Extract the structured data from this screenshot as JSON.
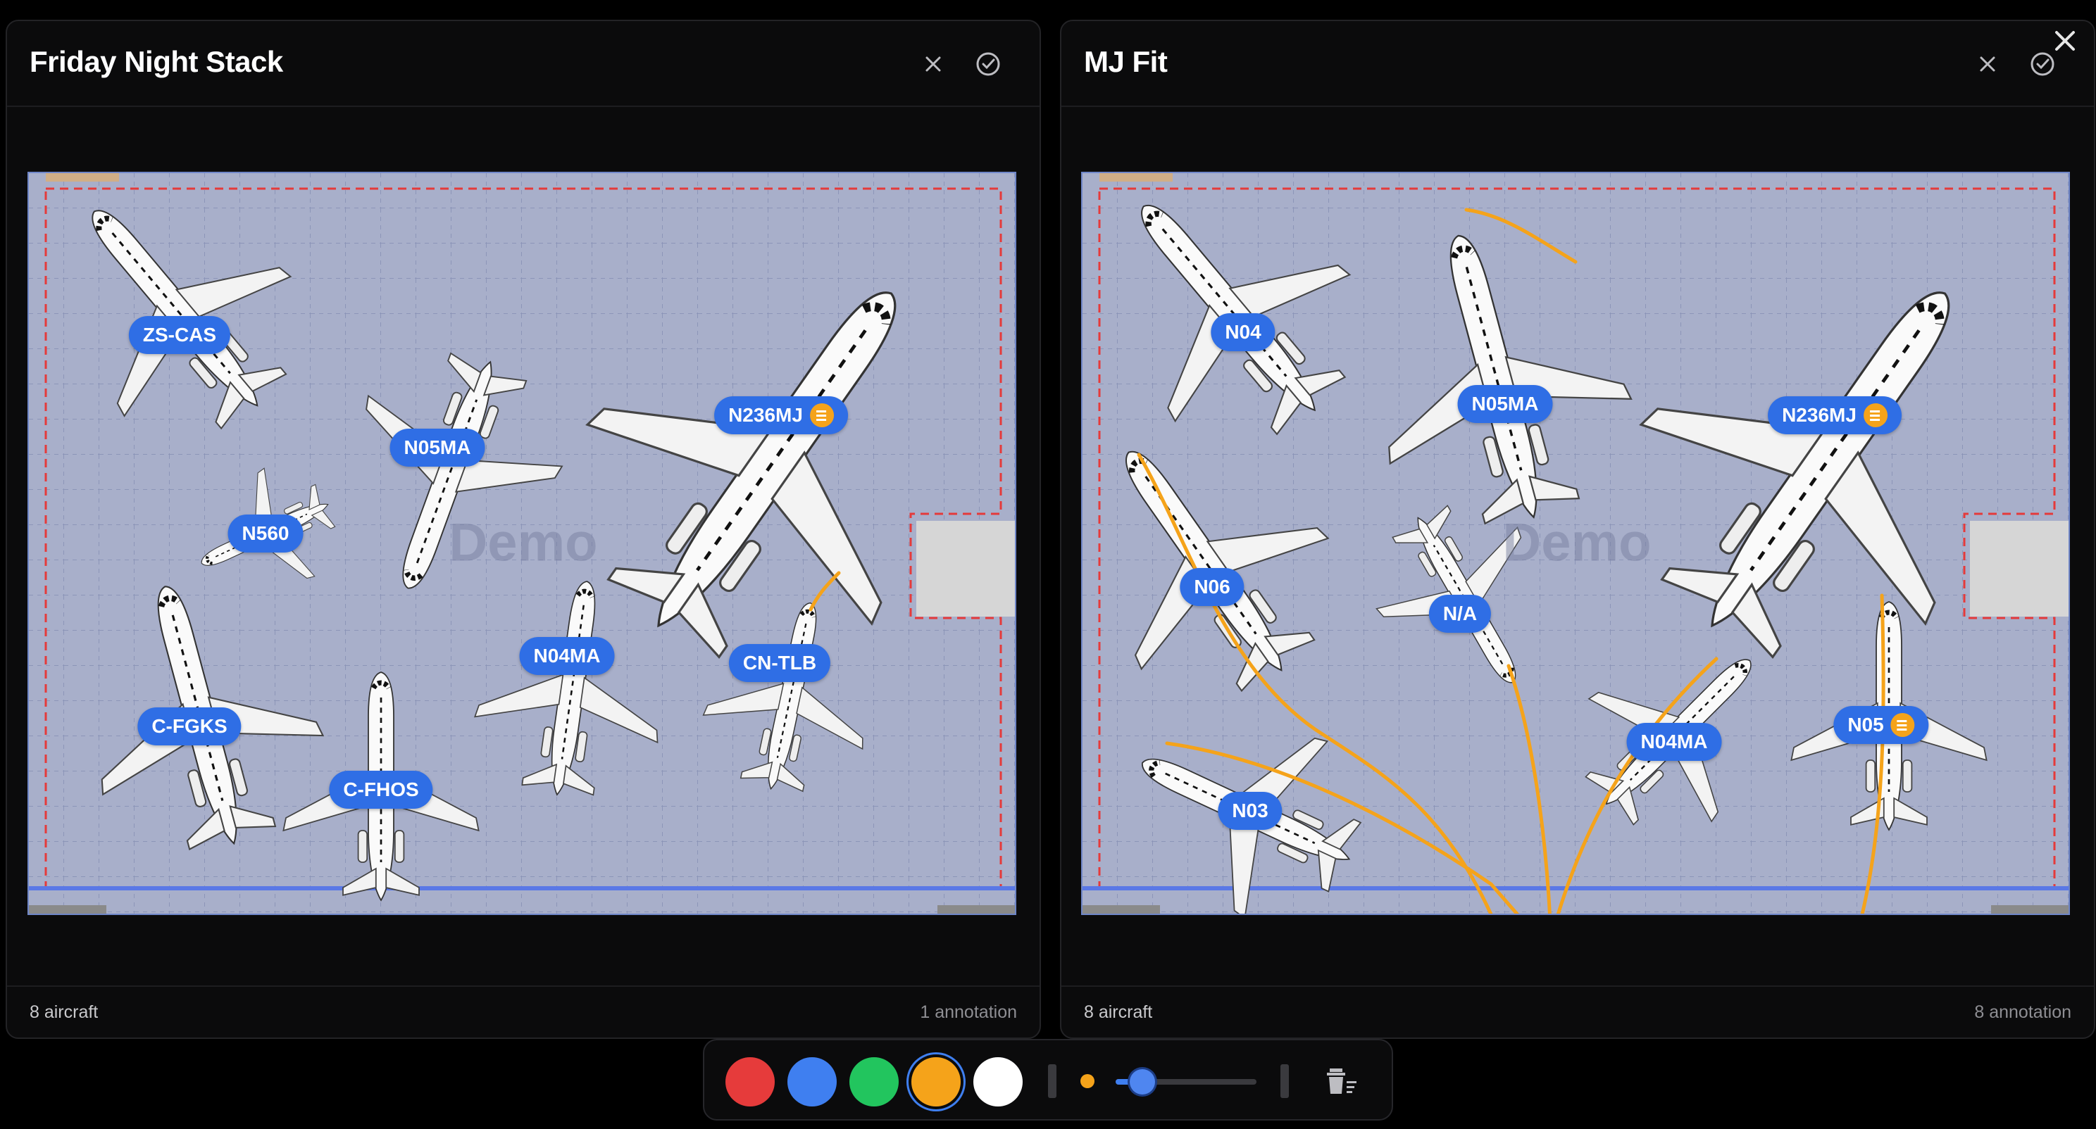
{
  "panels": [
    {
      "title": "Friday Night Stack",
      "footer_left": "8 aircraft",
      "footer_right": "1 annotation",
      "watermark": "Demo",
      "aircraft": [
        {
          "label": "ZS-CAS",
          "note": false
        },
        {
          "label": "N05MA",
          "note": false
        },
        {
          "label": "N236MJ",
          "note": true
        },
        {
          "label": "N560",
          "note": false
        },
        {
          "label": "N04MA",
          "note": false
        },
        {
          "label": "CN-TLB",
          "note": false
        },
        {
          "label": "C-FGKS",
          "note": false
        },
        {
          "label": "C-FHOS",
          "note": false
        }
      ]
    },
    {
      "title": "MJ Fit",
      "footer_left": "8 aircraft",
      "footer_right": "8 annotation",
      "watermark": "Demo",
      "aircraft": [
        {
          "label": "N04",
          "note": false
        },
        {
          "label": "N05MA",
          "note": false
        },
        {
          "label": "N236MJ",
          "note": true
        },
        {
          "label": "N06",
          "note": false
        },
        {
          "label": "N/A",
          "note": false
        },
        {
          "label": "N04MA",
          "note": false
        },
        {
          "label": "N05",
          "note": true
        },
        {
          "label": "N03",
          "note": false
        }
      ]
    }
  ],
  "toolbar": {
    "colors": [
      "#e63b3b",
      "#3f7ff0",
      "#22c55e",
      "#f5a31a",
      "#ffffff"
    ],
    "selected_color": "#f5a31a",
    "brush_size_percent": 15,
    "icons": [
      "brush-size-dot-icon",
      "trash-icon"
    ]
  },
  "icons": {
    "panel_close": "close-icon",
    "panel_confirm": "check-circle-icon",
    "window_close": "close-icon"
  }
}
